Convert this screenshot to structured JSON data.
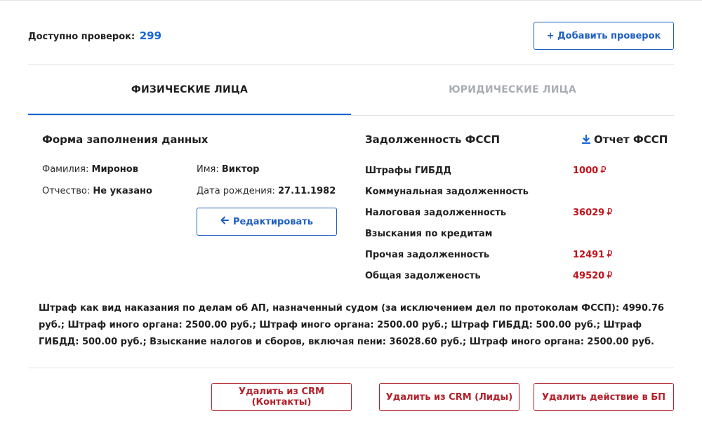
{
  "header": {
    "available_label": "Доступно проверок:",
    "available_count": "299",
    "add_button_label": "+ Добавить проверок"
  },
  "tabs": [
    {
      "label": "ФИЗИЧЕСКИЕ ЛИЦА",
      "active": true
    },
    {
      "label": "ЮРИДИЧЕСКИЕ ЛИЦА",
      "active": false
    }
  ],
  "form": {
    "title": "Форма заполнения данных",
    "surname_label": "Фамилия:",
    "surname_value": "Миронов",
    "name_label": "Имя:",
    "name_value": "Виктор",
    "patronymic_label": "Отчество:",
    "patronymic_value": "Не указано",
    "birthdate_label": "Дата рождения:",
    "birthdate_value": "27.11.1982",
    "edit_button_label": "Редактировать"
  },
  "debts": {
    "title": "Задолженность ФССП",
    "report_label": "Отчет ФССП",
    "currency": "₽",
    "rows": [
      {
        "label": "Штрафы ГИБДД",
        "amount": "1000"
      },
      {
        "label": "Коммунальная задолженность",
        "amount": ""
      },
      {
        "label": "Налоговая задолженность",
        "amount": "36029"
      },
      {
        "label": "Взыскания по кредитам",
        "amount": ""
      },
      {
        "label": "Прочая задолженность",
        "amount": "12491"
      },
      {
        "label": "Общая задолженость",
        "amount": "49520"
      }
    ]
  },
  "details_text": "Штраф как вид наказания по делам об АП, назначенный судом (за исключением дел по протоколам ФССП): 4990.76 руб.; Штраф иного органа: 2500.00 руб.; Штраф иного органа: 2500.00 руб.; Штраф ГИБДД: 500.00 руб.; Штраф ГИБДД: 500.00 руб.; Взыскание налогов и сборов, включая пени: 36028.60 руб.; Штраф иного органа: 2500.00 руб.",
  "actions": {
    "delete_contacts_label": "Удалить из CRM (Контакты)",
    "delete_leads_label": "Удалить из CRM (Лиды)",
    "delete_bp_label": "Удалить действие в БП"
  },
  "colors": {
    "accent_blue": "#1565d8",
    "danger_red": "#c0121b",
    "inactive_gray": "#a9adb3"
  }
}
